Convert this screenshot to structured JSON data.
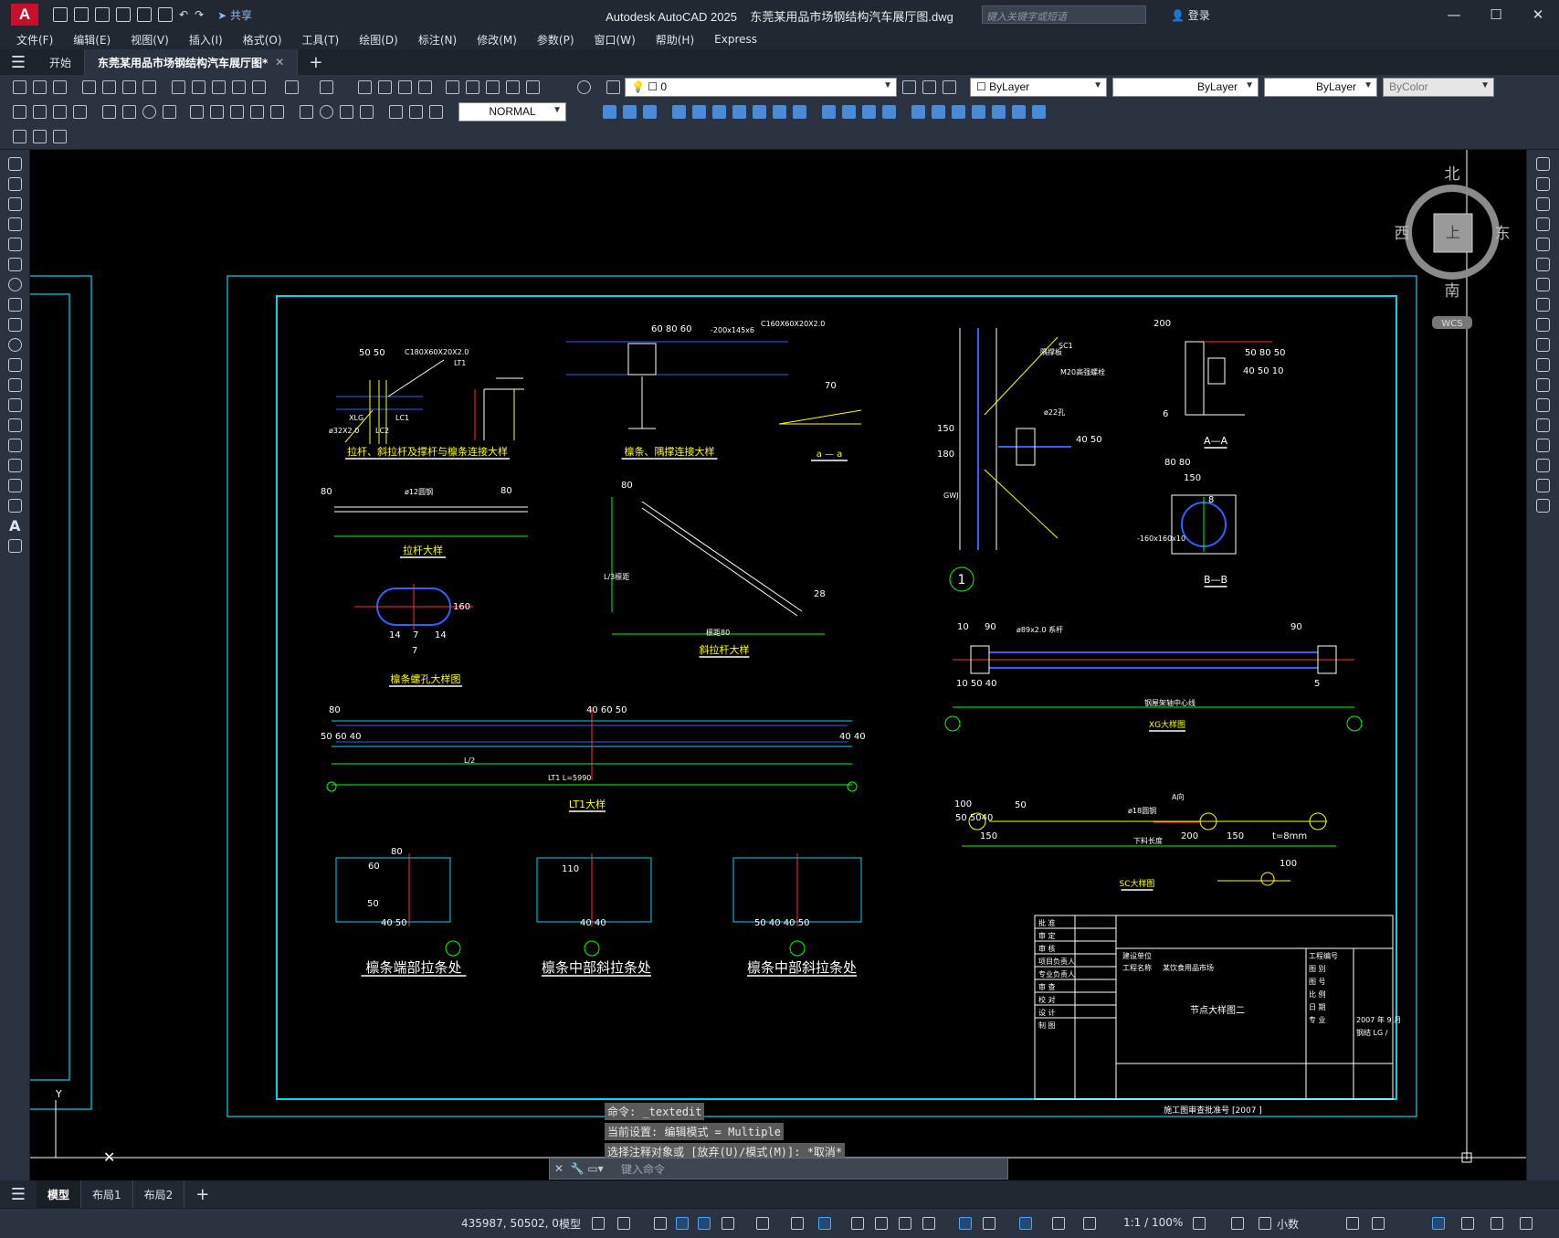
{
  "app": {
    "title": "Autodesk AutoCAD 2025",
    "document": "东莞某用品市场钢结构汽车展厅图.dwg",
    "logo": "A",
    "share": "共享"
  },
  "search": {
    "placeholder": "键入关键字或短语"
  },
  "account": {
    "login": "登录"
  },
  "menu": [
    "文件(F)",
    "编辑(E)",
    "视图(V)",
    "插入(I)",
    "格式(O)",
    "工具(T)",
    "绘图(D)",
    "标注(N)",
    "修改(M)",
    "参数(P)",
    "窗口(W)",
    "帮助(H)",
    "Express"
  ],
  "file_tabs": [
    {
      "label": "开始"
    },
    {
      "label": "东莞某用品市场钢结构汽车展厅图*"
    }
  ],
  "properties": {
    "layer": "0",
    "color": "ByLayer",
    "linetype": "ByLayer",
    "lineweight": "ByLayer",
    "plotstyle": "ByColor",
    "dimstyle": "NORMAL"
  },
  "viewcube": {
    "north": "北",
    "south": "南",
    "east": "东",
    "west": "西",
    "face": "上",
    "wcs": "WCS"
  },
  "drawing": {
    "titles": [
      "拉杆、斜拉杆及撑杆与檩条连接大样",
      "檩条、隅撑连接大样",
      "a — a",
      "拉杆大样",
      "斜拉杆大样",
      "檩条螺孔大样图",
      "LT1大样",
      "XG大样图",
      "SC大样图",
      "A—A",
      "B—B",
      "檩条端部拉条处",
      "檩条中部斜拉条处",
      "檩条中部斜拉条处"
    ],
    "labels": [
      "C180X60X20X2.0",
      "C160X60X20X2.0",
      "LT1",
      "-200x145x6",
      "ø12圆钢",
      "ø89x2.0 系杆",
      "M20高强螺栓",
      "ø22孔",
      "ø18圆钢",
      "XLG",
      "LC1",
      "LC2",
      "ø32X2.0",
      "SC1",
      "GWJ",
      "-160x160x10",
      "L/2",
      "LT1   L=5990",
      "L/3檩距",
      "檩距80",
      "钢屋架轴中心线",
      "下料长度",
      "隅撑板",
      "A向"
    ],
    "dims": [
      "50 50",
      "60 80 60",
      "70",
      "80",
      "80",
      "80",
      "28",
      "7",
      "14",
      "7",
      "14",
      "160",
      "80 80",
      "150",
      "150",
      "180",
      "40 50",
      "10",
      "90",
      "10 50 40",
      "90",
      "5",
      "80",
      "40 60 50",
      "50 60 40",
      "40 40",
      "80",
      "60",
      "50",
      "40 50",
      "110",
      "40 40",
      "50 40 40 50",
      "100",
      "50",
      "150",
      "200",
      "150",
      "t=8mm",
      "100",
      "50 5040",
      "200",
      "50 80 50",
      "40 50 10",
      "6",
      "8"
    ],
    "circle_label": "1",
    "title_block": {
      "rows": [
        "批 准",
        "审 定",
        "审 核",
        "项目负责人",
        "专业负责人",
        "审 查",
        "校 对",
        "设 计",
        "制 图"
      ],
      "owner_label": "建设单位",
      "project_label": "工程名称",
      "project": "某饮食用品市场",
      "drawing_name": "节点大样图二",
      "right": [
        "工程编号",
        "图 别",
        "图 号",
        "比 例",
        "日 期",
        "专 业"
      ],
      "date": "2007 年 9 月",
      "discipline": "钢结 LG /",
      "footer": "施工图审查批准号 [2007 ]"
    }
  },
  "command": {
    "history": [
      "命令: _textedit",
      "当前设置: 编辑模式 = Multiple",
      "选择注释对象或 [放弃(U)/模式(M)]: *取消*"
    ],
    "placeholder": "键入命令"
  },
  "layout_tabs": [
    "模型",
    "布局1",
    "布局2"
  ],
  "status": {
    "coords": "435987, 50502, 0",
    "space": "模型",
    "scale": "1:1 / 100%",
    "units": "小数"
  }
}
